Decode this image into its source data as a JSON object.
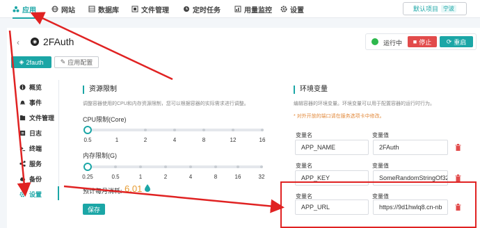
{
  "nav": {
    "items": [
      {
        "label": "应用",
        "icon": "apps-icon"
      },
      {
        "label": "网站",
        "icon": "globe-icon"
      },
      {
        "label": "数据库",
        "icon": "database-icon"
      },
      {
        "label": "文件管理",
        "icon": "folder-icon"
      },
      {
        "label": "定时任务",
        "icon": "clock-icon"
      },
      {
        "label": "用量监控",
        "icon": "chart-icon"
      },
      {
        "label": "设置",
        "icon": "gear-icon"
      }
    ],
    "project_label": "默认项目",
    "project_tag": "宁波"
  },
  "app": {
    "title": "2FAuth",
    "status": "运行中",
    "stop_label": "停止",
    "restart_label": "重启",
    "tag_primary": "2fauth",
    "tag_secondary": "应用配置"
  },
  "sidebar": {
    "items": [
      {
        "label": "概览",
        "icon": "info-icon"
      },
      {
        "label": "事件",
        "icon": "bell-icon"
      },
      {
        "label": "文件管理",
        "icon": "folder-icon"
      },
      {
        "label": "日志",
        "icon": "log-icon"
      },
      {
        "label": "终端",
        "icon": "terminal-icon"
      },
      {
        "label": "服务",
        "icon": "share-icon"
      },
      {
        "label": "备份",
        "icon": "cloud-icon"
      },
      {
        "label": "设置",
        "icon": "gear-icon"
      }
    ]
  },
  "resources": {
    "title": "资源限制",
    "desc": "调整容器使用的CPU和内存资源限制，您可以根据容器的实际需求进行调整。",
    "cpu_label": "CPU限制(Core)",
    "cpu_ticks": [
      "0.5",
      "1",
      "2",
      "4",
      "8",
      "12",
      "16"
    ],
    "cpu_value": "0.5",
    "mem_label": "内存限制(G)",
    "mem_ticks": [
      "0.25",
      "0.5",
      "1",
      "2",
      "4",
      "8",
      "16",
      "32"
    ],
    "mem_value": "0.25",
    "cost_label": "预计每月消耗:",
    "cost_value": "6.01",
    "save_label": "保存"
  },
  "env": {
    "title": "环境变量",
    "desc": "编辑容器的环境变量。环境变量可以用于配置容器的运行时行为。",
    "warning": "* 对外开放的端口请在服务选项卡中修改。",
    "name_header": "变量名",
    "value_header": "变量值",
    "rows": [
      {
        "name": "APP_NAME",
        "value": "2FAuth"
      },
      {
        "name": "APP_KEY",
        "value": "SomeRandomStringOf32"
      },
      {
        "name": "APP_URL",
        "value": "https://9d1hwlq8.cn-nb"
      }
    ]
  },
  "colors": {
    "accent": "#1ba6a6",
    "danger": "#e24b4b",
    "annotation": "#e02222",
    "cost": "#e69a2e"
  }
}
